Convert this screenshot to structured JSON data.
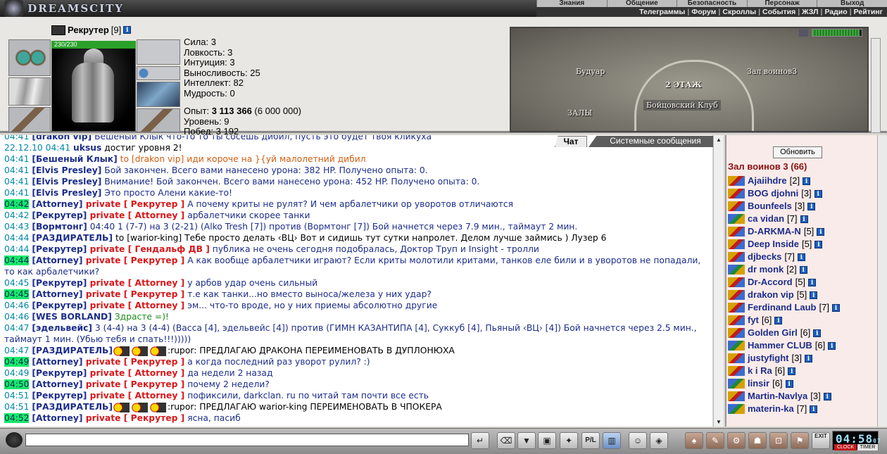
{
  "app": {
    "logo": "DREAMSCITY"
  },
  "menu_top": [
    "Знания",
    "Общение",
    "Безопасность",
    "Персонаж",
    "Выход"
  ],
  "menu_sub": [
    "Телеграммы",
    "Форум",
    "Скроллы",
    "События",
    "ЖЗЛ",
    "Радио",
    "Рейтинг"
  ],
  "character": {
    "name": "Рекрутер",
    "level": "[9]",
    "hp": "230/230",
    "stats": [
      "Сила: 3",
      "Ловкость: 3",
      "Интуиция: 3",
      "Выносливость: 25",
      "Интеллект: 82",
      "Мудрость: 0"
    ],
    "exp_label": "Опыт: ",
    "exp_value": "3 113 366",
    "exp_next": " (6 000 000)",
    "level_line": "Уровень: 9",
    "wins": "Побед: 3 192",
    "info": "i"
  },
  "map": {
    "rooms": [
      "Будуар",
      "Зал воинов3",
      "2 ЭТАЖ",
      "Бойцовский Клуб",
      "ЗАЛЫ"
    ]
  },
  "tabs": {
    "chat": "Чат",
    "system": "Системные сообщения"
  },
  "chat": {
    "lines": [
      {
        "t": "04:41",
        "nick": "[drakon vip]",
        "text": " Бешеный Клык что-то то ты сосешь дибил, пусть это будет твоя кликуха"
      },
      {
        "t": "22.12.10 04:41",
        "nick": "uksus",
        "text": " достиг уровня 2!"
      },
      {
        "t": "04:41",
        "nick": "[Бешеный Клык]",
        "text": " to [drakon vip] иди короче на }{уй малолетний дибил"
      },
      {
        "t": "04:41",
        "nick": "[Elvis Presley]",
        "text": " Бой закончен. Всего вами нанесено урона: 382 HP. Получено опыта: 0."
      },
      {
        "t": "04:41",
        "nick": "[Elvis Presley]",
        "text": " Внимание! Бой закончен. Всего вами нанесено урона: 452 HP. Получено опыта: 0."
      },
      {
        "t": "04:41",
        "nick": "[Elvis Presley]",
        "text": " Это просто Алени какие-то!"
      },
      {
        "t": "04:42",
        "nick": "[Attorney]",
        "priv": " private [ Рекрутер ]",
        "text": " А почему криты не рулят? И чем арбалетчики ор уворотов отличаются"
      },
      {
        "t": "04:42",
        "nick": "[Рекрутер]",
        "priv": " private [ Attorney ]",
        "text": " арбалетчики скорее танки"
      },
      {
        "t": "04:43",
        "nick": "[Вормтонг]",
        "text": " 04:40 1 (7-7) на 3 (2-21) (Alko Tresh [7]) против (Вормтонг [7]) Бой начнется через 7.9 мин., таймаут 2 мин."
      },
      {
        "t": "04:44",
        "nick": "[РАЗДИРАТЕЛЬ]",
        "text": " to [warior-king] Тебе просто делать ‹ВЦ› Вот и сидишь тут сутки напролет. Делом лучше займись ) Лузер 6"
      },
      {
        "t": "04:44",
        "nick": "[Рекрутер]",
        "priv": " private [ Гендальф ДВ ]",
        "text": " публика не очень сегодня подобралась, Доктор Труп и Insight - тролли"
      },
      {
        "t": "04:44",
        "nick": "[Attorney]",
        "priv": " private [ Рекрутер ]",
        "text": " А как вообще арбалетчики играют? Если криты молотили критами, танков еле били и в уворотов не попадали, то как арбалетчики?"
      },
      {
        "t": "04:45",
        "nick": "[Рекрутер]",
        "priv": " private [ Attorney ]",
        "text": " у арбов удар очень сильный"
      },
      {
        "t": "04:45",
        "nick": "[Attorney]",
        "priv": " private [ Рекрутер ]",
        "text": " т.е как танки...но вместо выноса/железа у них удар?"
      },
      {
        "t": "04:46",
        "nick": "[Рекрутер]",
        "priv": " private [ Attorney ]",
        "text": " эм... что-то вроде, но у них приемы абсолютно другие"
      },
      {
        "t": "04:46",
        "nick": "[WES BORLAND]",
        "text": " Здрасте =)!"
      },
      {
        "t": "04:47",
        "nick": "[эдельвейс]",
        "text": " 3 (4-4) на 3 (4-4) (Васса [4], эдельвейс [4]) против (ГИМН КАЗАНТИПА [4], Суккуб [4], Пьяный ‹ВЦ› [4]) Бой начнется через 2.5 мин., таймаут 1 мин. (Убью тебя и спать!!!)))))"
      },
      {
        "t": "04:47",
        "nick": "[РАЗДИРАТЕЛЬ]",
        "text": ":rupor: ПРЕДЛАГАЮ ДРАКОНА ПЕРЕИМЕНОВАТЬ В ДУПЛОНЮХА"
      },
      {
        "t": "04:49",
        "nick": "[Attorney]",
        "priv": " private [ Рекрутер ]",
        "text": " а когда последний раз уворот рулил? :)"
      },
      {
        "t": "04:49",
        "nick": "[Рекрутер]",
        "priv": " private [ Attorney ]",
        "text": " да недели 2 назад"
      },
      {
        "t": "04:50",
        "nick": "[Attorney]",
        "priv": " private [ Рекрутер ]",
        "text": " почему 2 недели?"
      },
      {
        "t": "04:51",
        "nick": "[Рекрутер]",
        "priv": " private [ Attorney ]",
        "text": " пофиксили, darkclan. ru по читай там почти все есть"
      },
      {
        "t": "04:51",
        "nick": "[РАЗДИРАТЕЛЬ]",
        "text": ":rupor: ПРЕДЛАГАЮ warior-king ПЕРЕИМЕНОВАТЬ В ЧПОКЕРА"
      },
      {
        "t": "04:52",
        "nick": "[Attorney]",
        "priv": " private [ Рекрутер ]",
        "text": " ясна, пасиб"
      }
    ]
  },
  "users": {
    "refresh": "Обновить",
    "room": "Зал воинов 3 (66)",
    "list": [
      {
        "name": "Ajaiihdre",
        "lvl": "[2]"
      },
      {
        "name": "BOG djohni",
        "lvl": "[3]"
      },
      {
        "name": "Bounfeels",
        "lvl": "[3]"
      },
      {
        "name": "ca vidan",
        "lvl": "[7]"
      },
      {
        "name": "D-ARKMA-N",
        "lvl": "[5]"
      },
      {
        "name": "Deep Inside",
        "lvl": "[5]"
      },
      {
        "name": "djbecks",
        "lvl": "[7]"
      },
      {
        "name": "dr monk",
        "lvl": "[2]"
      },
      {
        "name": "Dr-Accord",
        "lvl": "[5]"
      },
      {
        "name": "drakon vip",
        "lvl": "[5]"
      },
      {
        "name": "Ferdinand Laub",
        "lvl": "[7]"
      },
      {
        "name": "fyt",
        "lvl": "[6]"
      },
      {
        "name": "Golden Girl",
        "lvl": "[6]"
      },
      {
        "name": "Hammer CLUB",
        "lvl": "[6]"
      },
      {
        "name": "justyfight",
        "lvl": "[3]"
      },
      {
        "name": "k i Ra",
        "lvl": "[6]"
      },
      {
        "name": "linsir",
        "lvl": "[6]"
      },
      {
        "name": "Martin-Navlya",
        "lvl": "[3]"
      },
      {
        "name": "materin-ka",
        "lvl": "[7]"
      }
    ]
  },
  "clock": {
    "time": "04:58",
    "seconds": "07",
    "label_clock": "CLOCK",
    "label_timer": "TIMER"
  },
  "toolbar": {
    "exit": "EXIT",
    "pl": "P/L"
  },
  "colors": {
    "private": "#d8181b",
    "nick": "#1c2d8a",
    "highlight": "#19e86a"
  }
}
